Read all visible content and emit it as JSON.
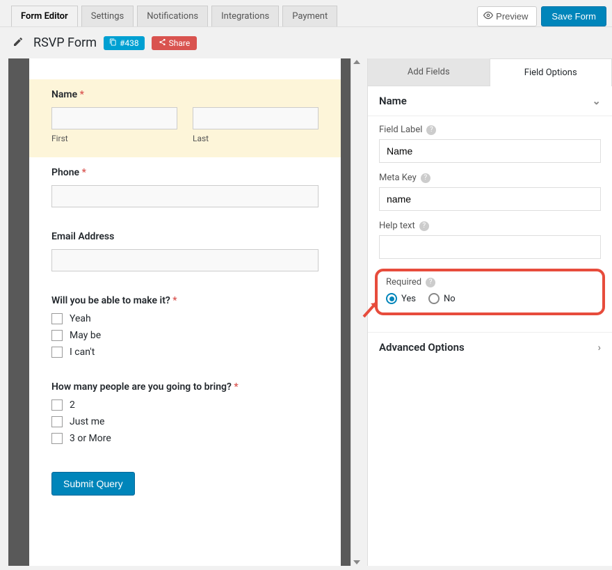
{
  "tabs": {
    "form_editor": "Form Editor",
    "settings": "Settings",
    "notifications": "Notifications",
    "integrations": "Integrations",
    "payment": "Payment"
  },
  "actions": {
    "preview": "Preview",
    "save": "Save Form"
  },
  "form": {
    "title": "RSVP Form",
    "id_badge": "#438",
    "share": "Share"
  },
  "canvas": {
    "name": {
      "label": "Name",
      "first": "First",
      "last": "Last",
      "required": true
    },
    "phone": {
      "label": "Phone",
      "required": true
    },
    "email": {
      "label": "Email Address",
      "required": false
    },
    "attend": {
      "label": "Will you be able to make it?",
      "required": true,
      "options": [
        "Yeah",
        "May be",
        "I can't"
      ]
    },
    "people": {
      "label": "How many people are you going to bring?",
      "required": true,
      "options": [
        "2",
        "Just me",
        "3 or More"
      ]
    },
    "submit": "Submit Query"
  },
  "sidebar": {
    "tabs": {
      "add": "Add Fields",
      "options": "Field Options"
    },
    "section_name": "Name",
    "field_label": {
      "label": "Field Label",
      "value": "Name"
    },
    "meta_key": {
      "label": "Meta Key",
      "value": "name"
    },
    "help_text": {
      "label": "Help text",
      "value": ""
    },
    "required": {
      "label": "Required",
      "yes": "Yes",
      "no": "No"
    },
    "advanced": "Advanced Options"
  }
}
